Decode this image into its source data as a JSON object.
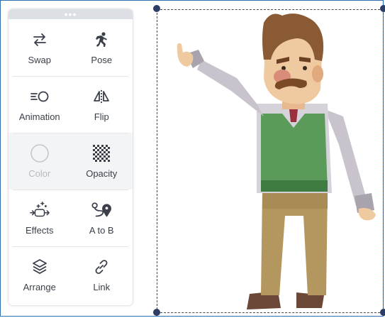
{
  "toolbar": {
    "grip": "•••",
    "tools": [
      {
        "id": "swap",
        "label": "Swap",
        "icon": "swap-arrows-icon"
      },
      {
        "id": "pose",
        "label": "Pose",
        "icon": "running-figure-icon"
      },
      {
        "id": "animation",
        "label": "Animation",
        "icon": "animation-icon"
      },
      {
        "id": "flip",
        "label": "Flip",
        "icon": "flip-icon"
      },
      {
        "id": "color",
        "label": "Color",
        "icon": "color-circle-icon",
        "disabled": true
      },
      {
        "id": "opacity",
        "label": "Opacity",
        "icon": "checkerboard-icon"
      },
      {
        "id": "effects",
        "label": "Effects",
        "icon": "sparkle-effects-icon"
      },
      {
        "id": "atob",
        "label": "A to B",
        "icon": "path-pins-icon"
      },
      {
        "id": "arrange",
        "label": "Arrange",
        "icon": "layers-icon"
      },
      {
        "id": "link",
        "label": "Link",
        "icon": "link-icon"
      }
    ]
  },
  "colors": {
    "frame": "#2f6fb0",
    "handle": "#2c3e66",
    "label": "#3a3f4a",
    "disabled": "#b5b9c0"
  }
}
